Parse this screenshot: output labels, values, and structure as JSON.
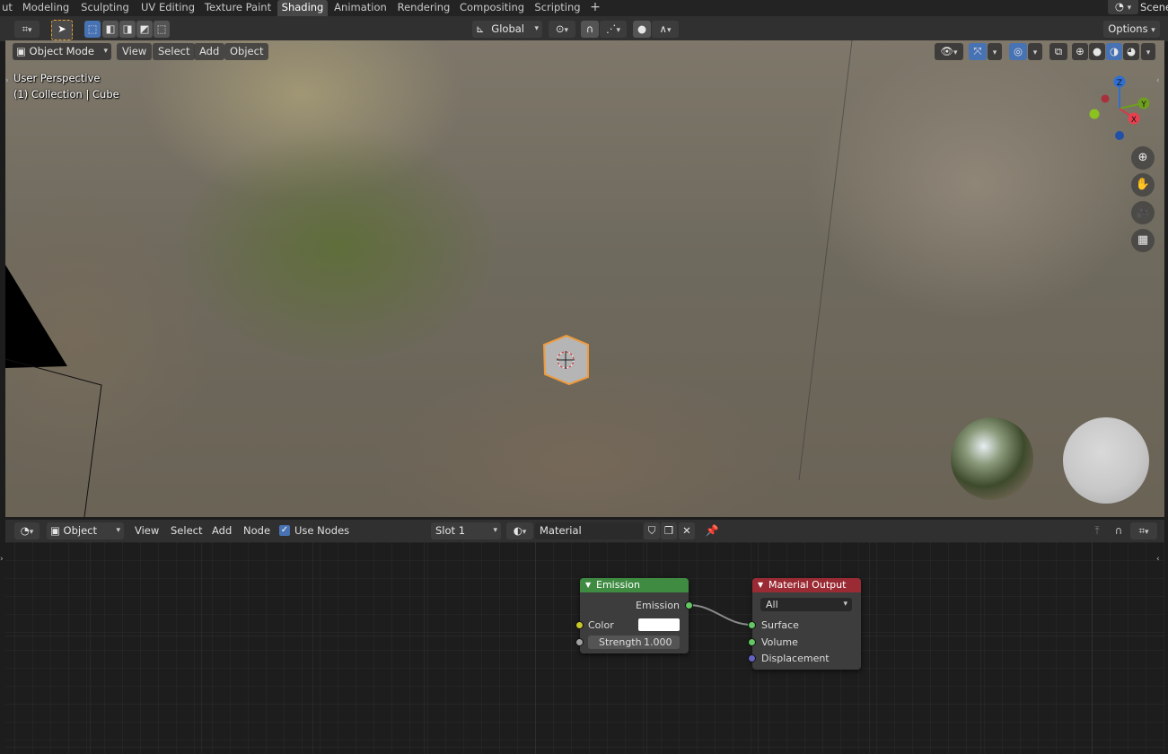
{
  "workspace_tabs": [
    "ut",
    "Modeling",
    "Sculpting",
    "UV Editing",
    "Texture Paint",
    "Shading",
    "Animation",
    "Rendering",
    "Compositing",
    "Scripting"
  ],
  "active_tab": "Shading",
  "add_tab": "+",
  "scene_label": "Scene",
  "tool_header": {
    "transform_orientation": "Global",
    "options_label": "Options"
  },
  "viewport_header": {
    "mode": "Object Mode",
    "menus": [
      "View",
      "Select",
      "Add",
      "Object"
    ]
  },
  "viewport": {
    "perspective": "User Perspective",
    "collection": "(1) Collection | Cube",
    "gizmo_axes": {
      "z": "Z",
      "y": "Y",
      "x": "X"
    }
  },
  "node_header": {
    "object_type": "Object",
    "menus": [
      "View",
      "Select",
      "Add",
      "Node"
    ],
    "use_nodes_label": "Use Nodes",
    "use_nodes_checked": true,
    "slot": "Slot 1",
    "material": "Material"
  },
  "nodes": {
    "emission": {
      "title": "Emission",
      "output": "Emission",
      "color_label": "Color",
      "color_value": "#ffffff",
      "strength_label": "Strength",
      "strength_value": "1.000"
    },
    "material_output": {
      "title": "Material Output",
      "target": "All",
      "inputs": [
        "Surface",
        "Volume",
        "Displacement"
      ]
    }
  },
  "colors": {
    "active_tab": "#474747",
    "emission_header": "#3f8b42",
    "output_header": "#9a2a33",
    "selection_outline": "#f09a3a",
    "accent_blue": "#4772b3"
  }
}
